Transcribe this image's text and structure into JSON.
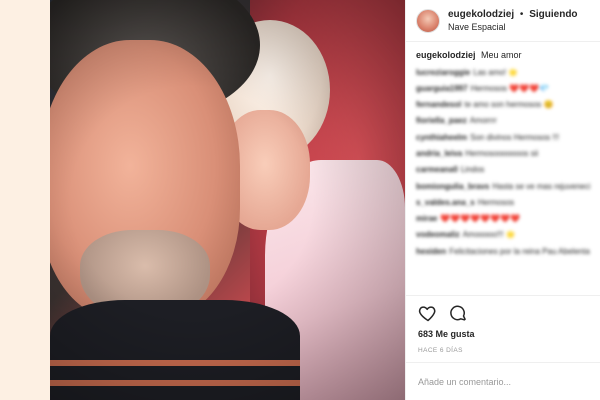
{
  "post": {
    "username": "eugekolodziej",
    "separator": "•",
    "follow_status": "Siguiendo",
    "location": "Nave Espacial",
    "caption": "Meu amor",
    "likes": "683 Me gusta",
    "time_ago": "HACE 6 DÍAS",
    "comment_placeholder": "Añade un comentario..."
  },
  "comments": [
    {
      "user": "lucreziaroggie",
      "text": "Las amo! 🌟"
    },
    {
      "user": "guarguia1997",
      "text": "Hermosos ❤️❤️❤️💎"
    },
    {
      "user": "fernandesol",
      "text": "te amo son hermosos 😊"
    },
    {
      "user": "fioriella_paez",
      "text": "Amorrrr"
    },
    {
      "user": "cynthiaheelm",
      "text": "Son divinos Hermosos !!!"
    },
    {
      "user": "andria_leiva",
      "text": "Hermosooooooos sii"
    },
    {
      "user": "carmeana0",
      "text": "Lindos"
    },
    {
      "user": "bomiongulia_bravs",
      "text": "Hasta se ve mas rejuvenecido @chicasamonica 😊"
    },
    {
      "user": "s_valdes.ana_s",
      "text": "Hermosos"
    },
    {
      "user": "mirae",
      "text": "❤️❤️❤️❤️❤️❤️❤️❤️"
    },
    {
      "user": "vodeomaliz",
      "text": "Amooooo!!! 🌟"
    },
    {
      "user": "hexiden",
      "text": "Felicitaciones por la reina Pau Abelenta"
    }
  ],
  "icons": {
    "avatar": "profile-avatar",
    "like": "heart-icon",
    "comment": "comment-bubble-icon"
  }
}
